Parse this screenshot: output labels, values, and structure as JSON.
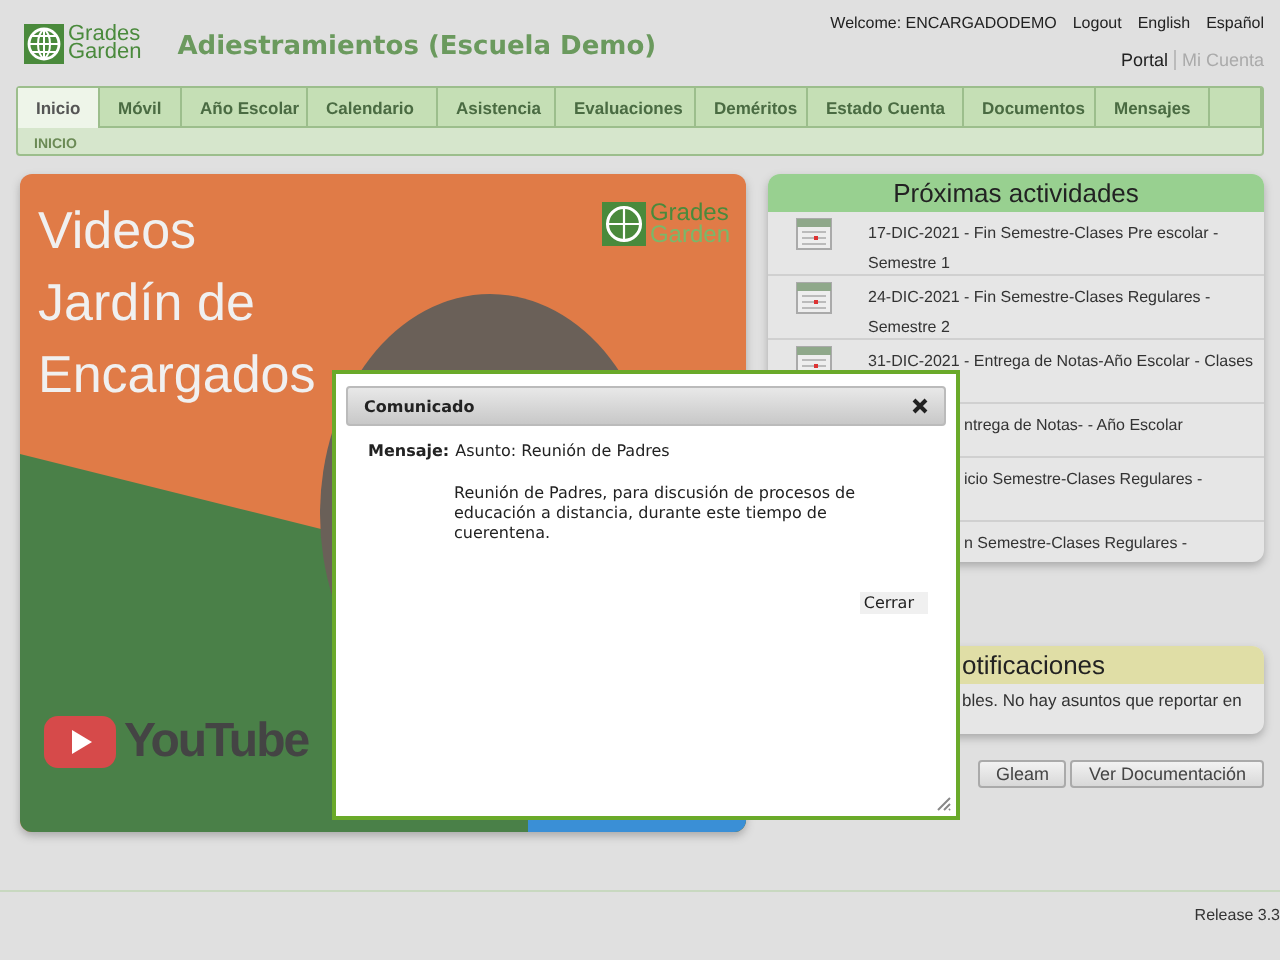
{
  "header": {
    "logo": [
      "Grades",
      "Garden"
    ],
    "title": "Adiestramientos (Escuela Demo)",
    "welcome": "Welcome: ENCARGADODEMO",
    "links": [
      "Logout",
      "English",
      "Español"
    ],
    "portal_links": [
      {
        "label": "Portal",
        "selected": true
      },
      {
        "label": "Mi Cuenta",
        "selected": false
      }
    ]
  },
  "tabs": [
    {
      "label": "Inicio",
      "selected": true
    },
    {
      "label": "Móvil",
      "selected": false
    },
    {
      "label": "Año Escolar",
      "selected": false
    },
    {
      "label": "Calendario",
      "selected": false
    },
    {
      "label": "Asistencia",
      "selected": false
    },
    {
      "label": "Evaluaciones",
      "selected": false
    },
    {
      "label": "Deméritos",
      "selected": false
    },
    {
      "label": "Estado Cuenta",
      "selected": false
    },
    {
      "label": "Documentos",
      "selected": false
    },
    {
      "label": "Mensajes",
      "selected": false
    }
  ],
  "breadcrumb": "INICIO",
  "banner": {
    "title": [
      "Videos",
      "Jardín de",
      "Encargados"
    ],
    "logo": [
      "Grades",
      "Garden"
    ],
    "youtube": "YouTube"
  },
  "activities": {
    "title": "Próximas actividades",
    "items": [
      {
        "text": "17-DIC-2021 - Fin Semestre-Clases Pre escolar - Semestre 1",
        "covered": false
      },
      {
        "text": "24-DIC-2021 - Fin Semestre-Clases Regulares - Semestre 2",
        "covered": false
      },
      {
        "text": "31-DIC-2021 - Entrega de Notas-Año Escolar - Clases",
        "covered": false
      },
      {
        "text": "ntrega de Notas- - Año Escolar",
        "covered": true
      },
      {
        "text": "icio Semestre-Clases Regulares -",
        "covered": true
      },
      {
        "text": "n Semestre-Clases Regulares -",
        "covered": true
      }
    ]
  },
  "notifications": {
    "title": "otificaciones",
    "text": "bles. No hay asuntos que reportar en"
  },
  "buttons": [
    "Gleam",
    "Ver Documentación"
  ],
  "footer": "Release 3.3",
  "dialog": {
    "title": "Comunicado",
    "label": "Mensaje:",
    "subject": "Asunto: Reunión de Padres",
    "body": "Reunión de Padres, para discusión de procesos de educación a distancia, durante este tiempo de cuerentena.",
    "close_button": "Cerrar"
  }
}
